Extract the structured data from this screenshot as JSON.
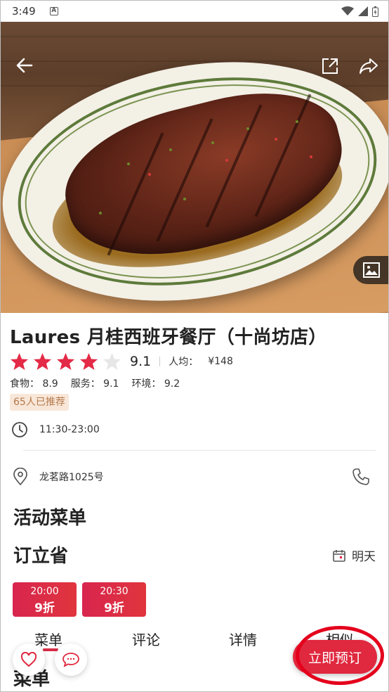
{
  "status_bar": {
    "time": "3:49",
    "sim_glyph": "A"
  },
  "restaurant": {
    "name": "Laures 月桂西班牙餐厅（十尚坊店）",
    "rating_stars": 4,
    "rating_max": 5,
    "score": "9.1",
    "avg_label": "人均：",
    "avg_price": "¥148",
    "sub_scores": [
      {
        "label": "食物：",
        "value": "8.9"
      },
      {
        "label": "服务：",
        "value": "9.1"
      },
      {
        "label": "环境：",
        "value": "9.2"
      }
    ],
    "recommend_badge": "65人已推荐",
    "hours": "11:30-23:00",
    "address": "龙茗路1025号"
  },
  "sections": {
    "activity_menu": "活动菜单",
    "booking": "订立省",
    "date_label": "明天"
  },
  "time_slots": [
    {
      "time": "20:00",
      "discount": "9折"
    },
    {
      "time": "20:30",
      "discount": "9折"
    }
  ],
  "tabs": [
    {
      "label": "菜单"
    },
    {
      "label": "评论"
    },
    {
      "label": "详情"
    },
    {
      "label": "相似"
    }
  ],
  "menu_heading": "菜单",
  "book_button": "立即预订",
  "icons": {
    "back": "back-arrow-icon",
    "open_external": "open-external-icon",
    "share": "share-icon",
    "gallery": "image-gallery-icon",
    "clock": "clock-icon",
    "location": "location-pin-icon",
    "phone": "phone-icon",
    "calendar": "calendar-icon",
    "favorite": "heart-icon",
    "comment": "chat-bubble-icon"
  },
  "colors": {
    "accent": "#e0283e",
    "star": "#e32a46",
    "badge_bg": "#f8e7d8",
    "badge_text": "#b57a4c",
    "annotation": "#e4001c"
  }
}
